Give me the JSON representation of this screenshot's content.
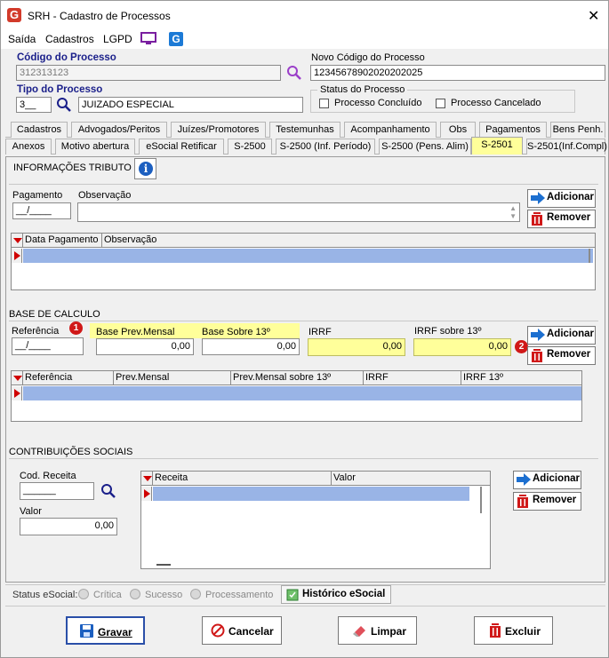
{
  "window": {
    "title": "SRH - Cadastro de Processos"
  },
  "menu": {
    "items": [
      "Saída",
      "Cadastros",
      "LGPD"
    ]
  },
  "form": {
    "codigo_label": "Código do Processo",
    "codigo_value": "312313123",
    "novo_codigo_label": "Novo Código do Processo",
    "novo_codigo_value": "12345678902020202025",
    "tipo_label": "Tipo do Processo",
    "tipo_code": "3__",
    "tipo_desc": "JUIZADO ESPECIAL",
    "status_label": "Status do Processo",
    "status_concluido": "Processo Concluído",
    "status_cancelado": "Processo Cancelado"
  },
  "tabs_row1": [
    "Cadastros",
    "Advogados/Peritos",
    "Juízes/Promotores",
    "Testemunhas",
    "Acompanhamento",
    "Obs",
    "Pagamentos",
    "Bens Penh."
  ],
  "tabs_row2": [
    "Anexos",
    "Motivo abertura",
    "eSocial Retificar",
    "S-2500",
    "S-2500 (Inf. Período)",
    "S-2500 (Pens. Alim)",
    "S-2501",
    "S-2501(Inf.Compl)"
  ],
  "info": {
    "title": "INFORMAÇÕES TRIBUTO",
    "pagamento_label": "Pagamento",
    "pagamento_value": "__/____",
    "observacao_label": "Observação",
    "grid_cols": [
      "Data Pagamento",
      "Observação"
    ]
  },
  "base": {
    "title": "BASE DE CALCULO",
    "referencia_label": "Referência",
    "referencia_value": "__/____",
    "prev_label": "Base Prev.Mensal",
    "prev_value": "0,00",
    "b13_label": "Base Sobre 13º",
    "b13_value": "0,00",
    "irrf_label": "IRRF",
    "irrf_value": "0,00",
    "irrf13_label": "IRRF sobre  13º",
    "irrf13_value": "0,00",
    "badge1": "1",
    "badge2": "2",
    "grid_cols": [
      "Referência",
      "Prev.Mensal",
      "Prev.Mensal sobre 13º",
      "IRRF",
      "IRRF 13º"
    ]
  },
  "contrib": {
    "title": "CONTRIBUIÇÕES SOCIAIS",
    "cod_label": "Cod. Receita",
    "cod_value": "______",
    "valor_label": "Valor",
    "valor_value": "0,00",
    "grid_cols": [
      "Receita",
      "Valor"
    ]
  },
  "buttons": {
    "adicionar": "Adicionar",
    "remover": "Remover"
  },
  "status": {
    "label": "Status eSocial:",
    "critica": "Crítica",
    "sucesso": "Sucesso",
    "processamento": "Processamento",
    "historico": "Histórico eSocial"
  },
  "actions": {
    "gravar": "Gravar",
    "cancelar": "Cancelar",
    "limpar": "Limpar",
    "excluir": "Excluir"
  },
  "colors": {
    "highlight": "#ffff9a",
    "selected_row": "#99b4e6",
    "label_blue": "#1a1f8a",
    "badge": "#d01818"
  }
}
